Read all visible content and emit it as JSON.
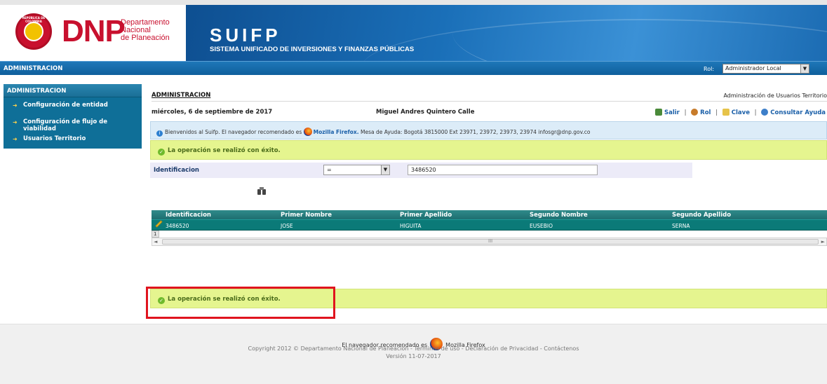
{
  "brand": {
    "seal_text": "REPÚBLICA DE COLOMBIA",
    "dnp": "DNP",
    "dnp_sub1": "Departamento",
    "dnp_sub2": "Nacional",
    "dnp_sub3": "de Planeación",
    "suifp": "SUIFP",
    "suifp_sub": "SISTEMA UNIFICADO DE INVERSIONES Y FINANZAS PÚBLICAS"
  },
  "navbar": {
    "title": "ADMINISTRACION",
    "rol_label": "Rol:",
    "rol_value": "Administrador Local"
  },
  "sidebar": {
    "header": "ADMINISTRACION",
    "items": [
      {
        "label": "Configuración de entidad"
      },
      {
        "label": "Configuración de flujo de viabilidad"
      },
      {
        "label": "Usuarios Territorio"
      }
    ]
  },
  "main": {
    "breadcrumb": "ADMINISTRACION",
    "breadcrumb_right": "Administración de Usuarios Territorio",
    "date": "miércoles, 6 de septiembre de 2017",
    "user": "Miguel Andres Quintero Calle",
    "links": {
      "salir": "Salir",
      "rol": "Rol",
      "clave": "Clave",
      "ayuda": "Consultar Ayuda"
    },
    "welcome_prefix": "Bienvenidos al Suifp. El navegador recomendado es",
    "welcome_browser": "Mozilla Firefox.",
    "welcome_suffix": "Mesa de Ayuda: Bogotá 3815000 Ext 23971, 23972, 23973, 23974 infosgr@dnp.gov.co",
    "success_msg": "La operación se realizó con éxito.",
    "filter": {
      "label": "Identificacion",
      "operator": "=",
      "value": "3486520"
    },
    "grid": {
      "columns": [
        "Identificacion",
        "Primer Nombre",
        "Primer Apellido",
        "Segundo Nombre",
        "Segundo Apellido"
      ],
      "rows": [
        [
          "3486520",
          "JOSE",
          "HIGUITA",
          "EUSEBIO",
          "SERNA"
        ]
      ],
      "page": "1",
      "scroll_grip": "III"
    }
  },
  "footer": {
    "browser_prefix": "El navegador recomendado es",
    "browser_name": "Mozilla Firefox",
    "copyright": "Copyright 2012 © Departamento Nacional de Planeación - Términos de uso - Declaración de Privacidad - Contáctenos",
    "version": "Versión 11-07-2017"
  },
  "colors": {
    "brand_red": "#c8102e",
    "banner_blue": "#1a6fb8",
    "sidebar_teal": "#0f6f98",
    "grid_teal": "#0b7a78",
    "success_bg": "#e5f58f",
    "highlight_red": "#e0141e"
  }
}
